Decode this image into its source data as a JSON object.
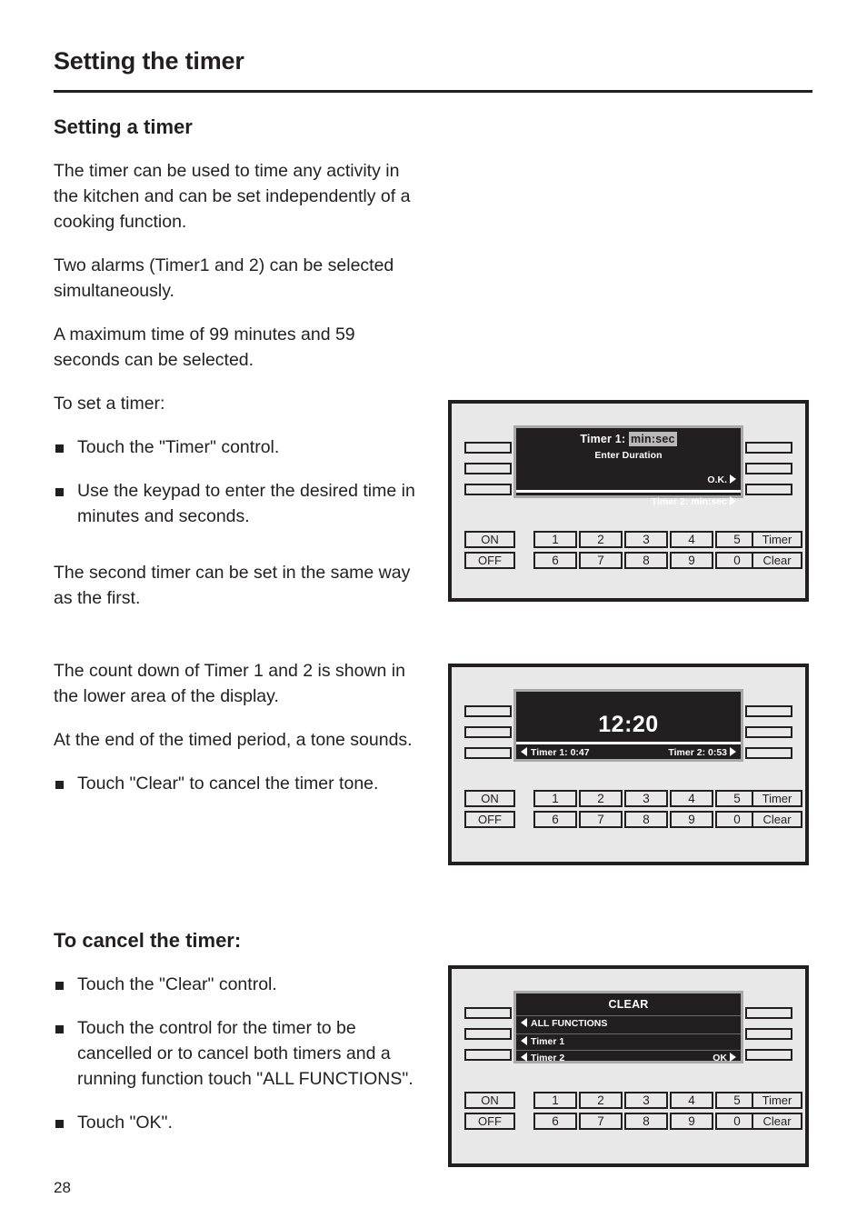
{
  "page": {
    "title": "Setting the timer",
    "number": "28"
  },
  "section1": {
    "heading": "Setting a timer",
    "paragraphs": [
      "The timer can be used to time any activity in the kitchen and can be set independently of a cooking function.",
      "Two alarms (Timer1 and 2) can be selected simultaneously.",
      "A maximum time of 99 minutes and 59 seconds can be selected.",
      "To set a timer:"
    ],
    "bullets": [
      "Touch the \"Timer\" control.",
      "Use the keypad to enter the desired time in minutes and seconds."
    ],
    "closing": "The second timer can be set in the same way as the first."
  },
  "section2": {
    "paragraphs": [
      "The count down of Timer 1 and 2 is shown in the lower area of the display.",
      "At the end of the timed period, a tone sounds."
    ],
    "bullets": [
      "Touch \"Clear\" to cancel the timer tone."
    ]
  },
  "section3": {
    "heading": "To cancel the timer:",
    "bullets": [
      "Touch the \"Clear\" control.",
      "Touch the control for the timer to be cancelled or to cancel both timers and a running function touch \"ALL FUNCTIONS\".",
      "Touch \"OK\"."
    ]
  },
  "keypad": {
    "on": "ON",
    "off": "OFF",
    "timer": "Timer",
    "clear": "Clear",
    "row1": [
      "1",
      "2",
      "3",
      "4",
      "5"
    ],
    "row2": [
      "6",
      "7",
      "8",
      "9",
      "0"
    ]
  },
  "panel1": {
    "display": {
      "title_prefix": "Timer 1:",
      "title_value": "min:sec",
      "subtitle": "Enter Duration",
      "ok_label": "O.K.",
      "timer2_label": "Timer 2: min:sec"
    }
  },
  "panel2": {
    "display": {
      "clock": "12:20",
      "timer1": "Timer 1: 0:47",
      "timer2": "Timer 2: 0:53"
    }
  },
  "panel3": {
    "display": {
      "title": "CLEAR",
      "option1": "ALL FUNCTIONS",
      "option2": "Timer 1",
      "option3": "Timer  2",
      "ok_label": "OK"
    }
  },
  "colors": {
    "ink": "#231f20",
    "panel_bg": "#e8e8e8",
    "lcd_bg": "#231f20",
    "lcd_bezel": "#a8a8a8",
    "highlight": "#b9b9b9"
  }
}
